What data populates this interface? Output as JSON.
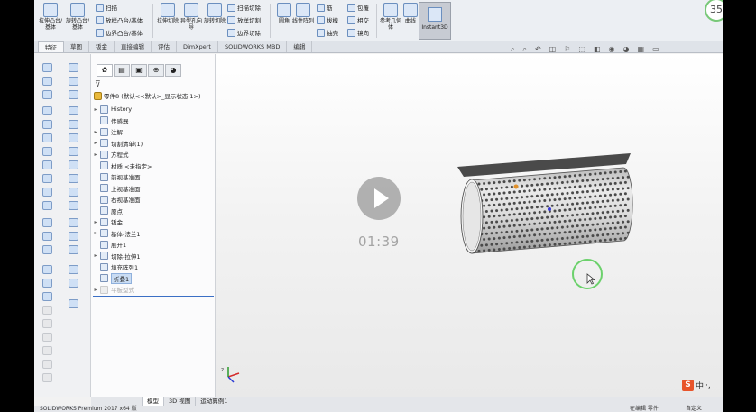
{
  "ribbon": {
    "big_buttons": [
      {
        "label": "拉伸凸台/基体",
        "icon": "extrude-boss-icon"
      },
      {
        "label": "旋转凸台/基体",
        "icon": "revolve-boss-icon"
      },
      {
        "label": "拉伸切除",
        "icon": "extrude-cut-icon"
      },
      {
        "label": "异型孔向导",
        "icon": "hole-wizard-icon"
      },
      {
        "label": "旋转切除",
        "icon": "revolve-cut-icon"
      },
      {
        "label": "圆角",
        "icon": "fillet-icon"
      },
      {
        "label": "线性阵列",
        "icon": "linear-pattern-icon"
      },
      {
        "label": "参考几何体",
        "icon": "reference-geometry-icon"
      },
      {
        "label": "曲线",
        "icon": "curves-icon"
      }
    ],
    "small_buttons_col1": [
      "扫描",
      "放样凸台/基体",
      "边界凸台/基体"
    ],
    "small_buttons_col2": [
      "扫描切除",
      "放样切割",
      "边界切除"
    ],
    "small_buttons_col3": [
      "筋",
      "拔模",
      "抽壳"
    ],
    "small_buttons_col4": [
      "包覆",
      "相交",
      "镜向"
    ],
    "instant3d_label": "Instant3D",
    "notification_count": "35"
  },
  "tabs": [
    "特征",
    "草图",
    "钣金",
    "直接编辑",
    "评估",
    "DimXpert",
    "SOLIDWORKS MBD",
    "编辑"
  ],
  "active_tab_index": 0,
  "tree": {
    "tab_icons": [
      "feature-manager-icon",
      "property-manager-icon",
      "configuration-manager-icon",
      "dimxpert-manager-icon",
      "display-manager-icon"
    ],
    "root_label": "零件8 (默认<<默认>_显示状态 1>)",
    "items": [
      {
        "label": "History",
        "expandable": true,
        "state": "normal"
      },
      {
        "label": "传感器",
        "expandable": false,
        "state": "normal"
      },
      {
        "label": "注解",
        "expandable": true,
        "state": "normal"
      },
      {
        "label": "切割清单(1)",
        "expandable": true,
        "state": "normal"
      },
      {
        "label": "方程式",
        "expandable": true,
        "state": "normal"
      },
      {
        "label": "材质 <未指定>",
        "expandable": false,
        "state": "normal"
      },
      {
        "label": "前视基准面",
        "expandable": false,
        "state": "normal"
      },
      {
        "label": "上视基准面",
        "expandable": false,
        "state": "normal"
      },
      {
        "label": "右视基准面",
        "expandable": false,
        "state": "normal"
      },
      {
        "label": "原点",
        "expandable": false,
        "state": "normal"
      },
      {
        "label": "钣金",
        "expandable": true,
        "state": "normal"
      },
      {
        "label": "基体-法兰1",
        "expandable": true,
        "state": "normal"
      },
      {
        "label": "展开1",
        "expandable": false,
        "state": "normal"
      },
      {
        "label": "切除-拉伸1",
        "expandable": true,
        "state": "normal"
      },
      {
        "label": "填充阵列1",
        "expandable": false,
        "state": "normal"
      },
      {
        "label": "折叠1",
        "expandable": false,
        "state": "selected"
      },
      {
        "label": "平板型式",
        "expandable": true,
        "state": "suppressed"
      }
    ]
  },
  "bottom_tabs": [
    "模型",
    "3D 视图",
    "运动算例1"
  ],
  "active_bottom_tab": 0,
  "status": {
    "app_name": "SOLIDWORKS Premium 2017 x64 版",
    "mid": "在编辑 零件",
    "right": "自定义"
  },
  "video": {
    "time": "01:39"
  },
  "ime": {
    "label": "中"
  },
  "colors": {
    "ribbon_bg": "#eceff3",
    "viewport_top": "#ffffff",
    "viewport_bottom": "#e9e9e9",
    "cursor_ring": "#6cd16c",
    "selection": "#c9dcf3",
    "part_gray": "#d8d8d8"
  }
}
